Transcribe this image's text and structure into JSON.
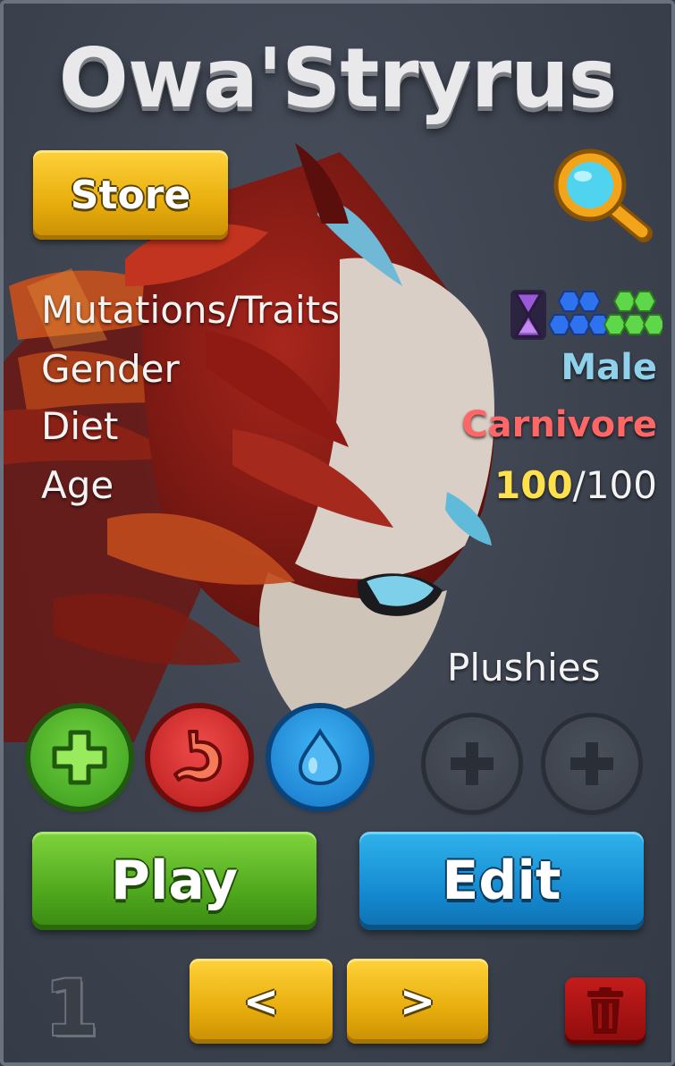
{
  "creature": {
    "name": "Owa'Stryrus",
    "icon": "griffin-portrait"
  },
  "store_button": {
    "label": "Store",
    "color": "#e7ad0c"
  },
  "search_button": {
    "icon": "magnifier-icon"
  },
  "stats": {
    "mutations_label": "Mutations/Traits",
    "mutation_icons": [
      "hourglass-icon",
      "blue-hexagons-icon",
      "green-hexagons-icon"
    ],
    "gender_label": "Gender",
    "gender_value": "Male",
    "diet_label": "Diet",
    "diet_value": "Carnivore",
    "age_label": "Age",
    "age_current": "100",
    "age_max": "/100",
    "colors": {
      "gender": "#8fd0ea",
      "diet": "#ff6666",
      "age_current": "#ffe14d"
    }
  },
  "plushies": {
    "label": "Plushies",
    "slots": [
      "plus-icon",
      "plus-icon"
    ]
  },
  "needs": {
    "icons": [
      "heal-plus-icon",
      "stomach-icon",
      "water-drop-icon"
    ]
  },
  "actions": {
    "play_label": "Play",
    "edit_label": "Edit",
    "colors": {
      "play": "#4da51c",
      "edit": "#1488cf"
    }
  },
  "pager": {
    "slot_number": "1",
    "prev_label": "<",
    "next_label": ">",
    "delete_icon": "trash-icon"
  }
}
